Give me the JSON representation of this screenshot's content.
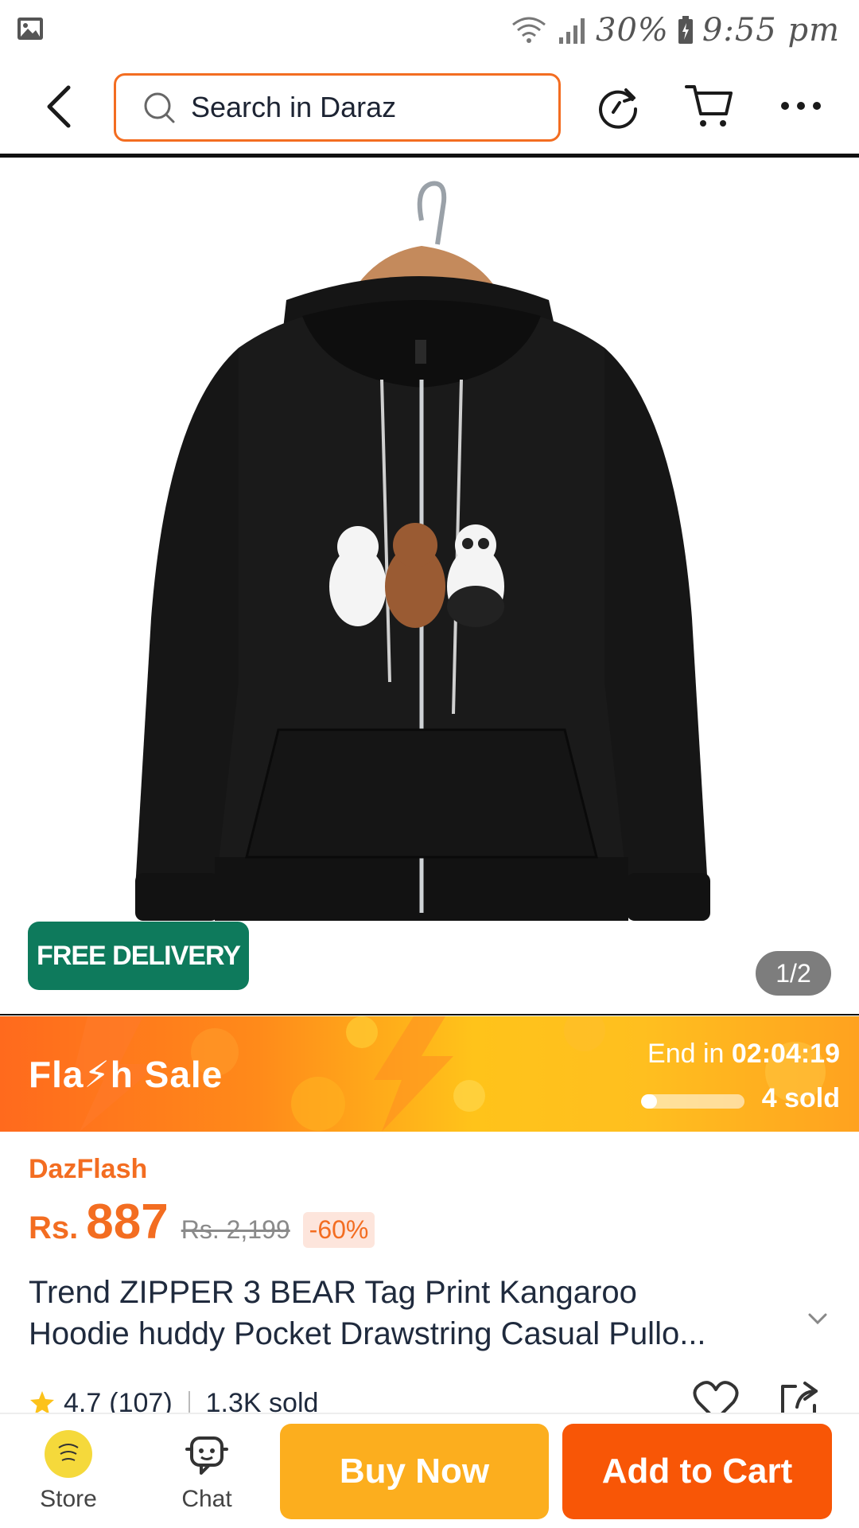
{
  "status_bar": {
    "battery": "30%",
    "time": "9:55 pm"
  },
  "header": {
    "search_placeholder": "Search in Daraz"
  },
  "gallery": {
    "free_delivery_badge": "FREE DELIVERY",
    "page_indicator": "1/2"
  },
  "flash_sale": {
    "title": "Fla⚡h  Sale",
    "end_label": "End in",
    "countdown": "02:04:19",
    "sold_progress": 0.15,
    "sold": "4 sold"
  },
  "price": {
    "tag": "DazFlash",
    "currency": "Rs.",
    "current": "887",
    "original": "Rs. 2,199",
    "discount": "-60%"
  },
  "product": {
    "title_line1": "Trend ZIPPER 3 BEAR Tag Print Kangaroo",
    "title_line2": "Hoodie huddy Pocket Drawstring Casual Pullo..."
  },
  "rating": {
    "score": "4.7",
    "count": "(107)",
    "sold": "1.3K sold"
  },
  "bottom_bar": {
    "store_label": "Store",
    "chat_label": "Chat",
    "buy_now": "Buy Now",
    "add_to_cart": "Add to Cart"
  },
  "colors": {
    "brand_orange": "#f36d21",
    "buy_now": "#fcae1e",
    "add_to_cart": "#f85606",
    "free_delivery": "#0e7a5c"
  }
}
